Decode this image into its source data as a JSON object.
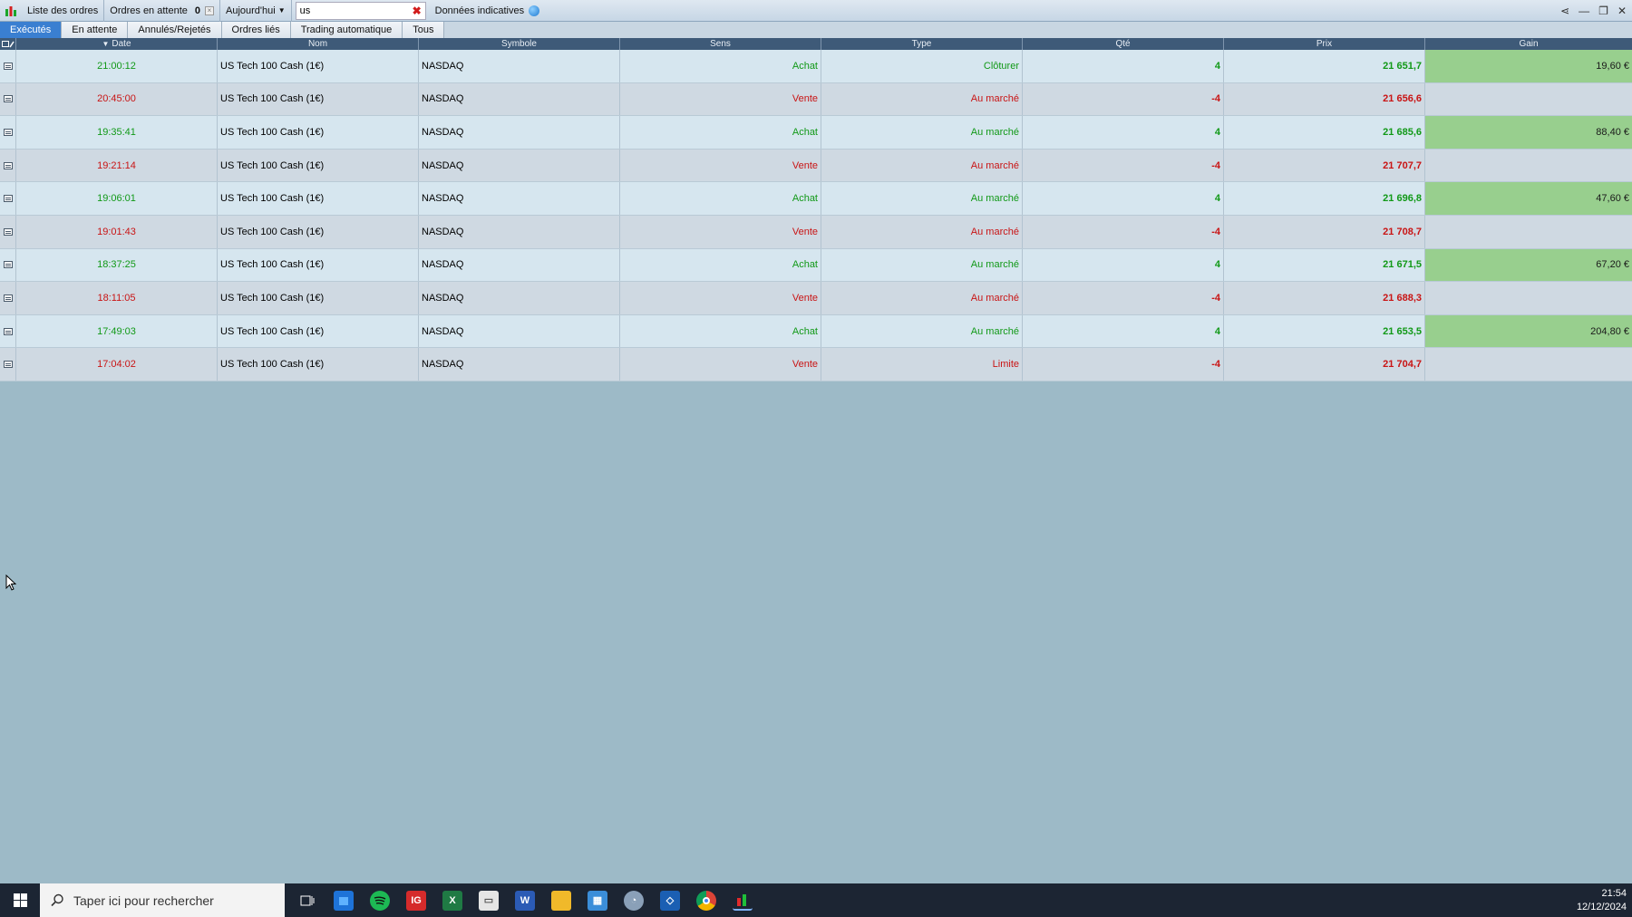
{
  "toolbar": {
    "order_list": "Liste des ordres",
    "pending_orders_label": "Ordres en attente",
    "pending_orders_count": "0",
    "period": "Aujourd'hui",
    "search_value": "us",
    "indicative": "Données indicatives"
  },
  "tabs": [
    {
      "label": "Exécutés",
      "active": true
    },
    {
      "label": "En attente"
    },
    {
      "label": "Annulés/Rejetés"
    },
    {
      "label": "Ordres liés"
    },
    {
      "label": "Trading automatique"
    },
    {
      "label": "Tous"
    }
  ],
  "columns": [
    "Date",
    "Nom",
    "Symbole",
    "Sens",
    "Type",
    "Qté",
    "Prix",
    "Gain"
  ],
  "rows": [
    {
      "date": "21:00:12",
      "nom": "US Tech 100 Cash (1€)",
      "symbole": "NASDAQ",
      "sens": "Achat",
      "type": "Clôturer",
      "qte": "4",
      "prix": "21 651,7",
      "gain": "19,60 €"
    },
    {
      "date": "20:45:00",
      "nom": "US Tech 100 Cash (1€)",
      "symbole": "NASDAQ",
      "sens": "Vente",
      "type": "Au marché",
      "qte": "-4",
      "prix": "21 656,6",
      "gain": ""
    },
    {
      "date": "19:35:41",
      "nom": "US Tech 100 Cash (1€)",
      "symbole": "NASDAQ",
      "sens": "Achat",
      "type": "Au marché",
      "qte": "4",
      "prix": "21 685,6",
      "gain": "88,40 €"
    },
    {
      "date": "19:21:14",
      "nom": "US Tech 100 Cash (1€)",
      "symbole": "NASDAQ",
      "sens": "Vente",
      "type": "Au marché",
      "qte": "-4",
      "prix": "21 707,7",
      "gain": ""
    },
    {
      "date": "19:06:01",
      "nom": "US Tech 100 Cash (1€)",
      "symbole": "NASDAQ",
      "sens": "Achat",
      "type": "Au marché",
      "qte": "4",
      "prix": "21 696,8",
      "gain": "47,60 €"
    },
    {
      "date": "19:01:43",
      "nom": "US Tech 100 Cash (1€)",
      "symbole": "NASDAQ",
      "sens": "Vente",
      "type": "Au marché",
      "qte": "-4",
      "prix": "21 708,7",
      "gain": ""
    },
    {
      "date": "18:37:25",
      "nom": "US Tech 100 Cash (1€)",
      "symbole": "NASDAQ",
      "sens": "Achat",
      "type": "Au marché",
      "qte": "4",
      "prix": "21 671,5",
      "gain": "67,20 €"
    },
    {
      "date": "18:11:05",
      "nom": "US Tech 100 Cash (1€)",
      "symbole": "NASDAQ",
      "sens": "Vente",
      "type": "Au marché",
      "qte": "-4",
      "prix": "21 688,3",
      "gain": ""
    },
    {
      "date": "17:49:03",
      "nom": "US Tech 100 Cash (1€)",
      "symbole": "NASDAQ",
      "sens": "Achat",
      "type": "Au marché",
      "qte": "4",
      "prix": "21 653,5",
      "gain": "204,80 €"
    },
    {
      "date": "17:04:02",
      "nom": "US Tech 100 Cash (1€)",
      "symbole": "NASDAQ",
      "sens": "Vente",
      "type": "Limite",
      "qte": "-4",
      "prix": "21 704,7",
      "gain": ""
    }
  ],
  "taskbar": {
    "search_placeholder": "Taper ici pour rechercher",
    "time": "21:54",
    "date": "12/12/2024",
    "apps": [
      "task-view-icon",
      "store-icon",
      "spotify-icon",
      "ig-icon",
      "excel-icon",
      "files-icon",
      "word-icon",
      "explorer-icon",
      "calculator-icon",
      "paint-icon",
      "vscode-icon",
      "chrome-icon",
      "trading-chart-icon"
    ]
  },
  "colors": {
    "buy": "#119917",
    "sell": "#c91414",
    "gain_positive": "#98cf8e",
    "header": "#3e5a78",
    "active_tab": "#3a7fd1"
  }
}
